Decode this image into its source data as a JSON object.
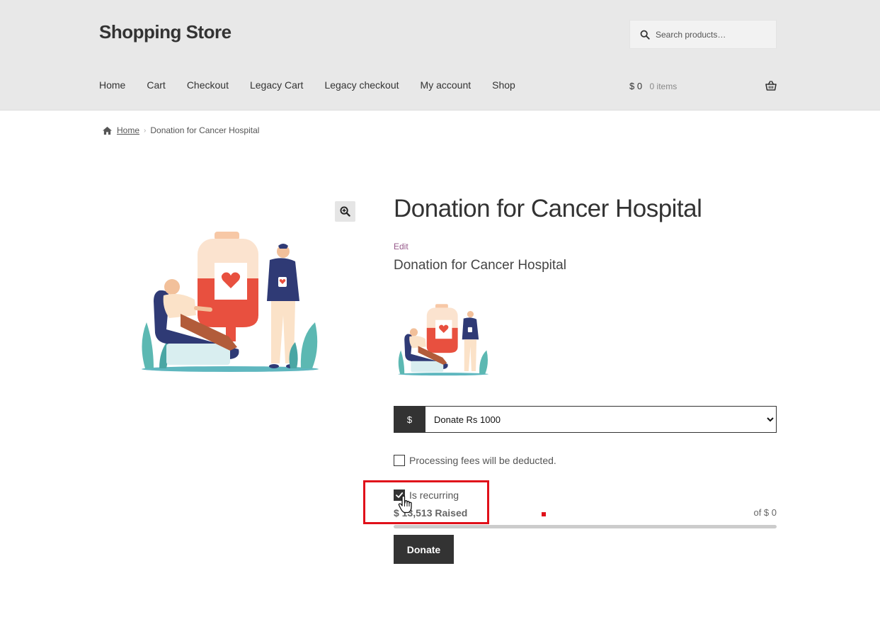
{
  "site": {
    "title": "Shopping Store"
  },
  "search": {
    "placeholder": "Search products…"
  },
  "nav": {
    "items": [
      "Home",
      "Cart",
      "Checkout",
      "Legacy Cart",
      "Legacy checkout",
      "My account",
      "Shop"
    ]
  },
  "cart": {
    "amount": "$ 0",
    "count": "0 items"
  },
  "breadcrumb": {
    "home": "Home",
    "separator": "›",
    "current": "Donation for Cancer Hospital"
  },
  "product": {
    "title": "Donation for Cancer Hospital",
    "edit_label": "Edit",
    "short_description": "Donation for Cancer Hospital"
  },
  "donation": {
    "currency_symbol": "$",
    "selected_option": "Donate Rs 1000",
    "fees_label": "Processing fees will be deducted.",
    "fees_checked": false,
    "recurring_label": "Is recurring",
    "recurring_checked": true,
    "raised_text": "$ 13,513 Raised",
    "goal_text": "of $ 0",
    "progress_percent": 0,
    "button_label": "Donate"
  },
  "icons": {
    "search": "search-icon",
    "basket": "basket-icon",
    "home": "home-icon",
    "zoom": "zoom-in-icon",
    "check": "check-icon",
    "cursor": "hand-pointer-cursor-icon"
  },
  "colors": {
    "header_bg": "#e8e8e8",
    "dark": "#333333",
    "edit_link": "#96588a",
    "highlight": "#e0101a"
  }
}
